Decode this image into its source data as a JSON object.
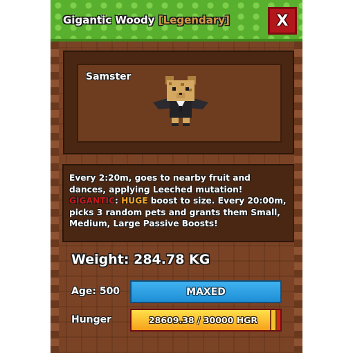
{
  "header": {
    "pet_type": "Gigantic Woody",
    "rarity": "[Legendary]",
    "close_label": "X"
  },
  "preview": {
    "pet_name": "Samster"
  },
  "description": {
    "line1": "Every 2:20m, goes to nearby fruit and dances, applying Leeched mutation!",
    "gigantic_word": "GIGANTIC",
    "colon": ":",
    "huge_word": "HUGE",
    "line2": "boost to size. Every 20:00m, picks 3 random pets and grants them Small, Medium, Large Passive Boosts!"
  },
  "stats": {
    "weight_text": "Weight: 284.78 KG",
    "age_label": "Age: 500",
    "age_status": "MAXED",
    "hunger_label": "Hunger",
    "hunger_text": "28609.38 / 30000 HGR",
    "hunger_current": 28609.38,
    "hunger_max": 30000
  },
  "colors": {
    "header_green": "#59b02e",
    "close_red": "#b3171c",
    "rarity_tan": "#d39a4a",
    "gigantic_red": "#c21a1a",
    "huge_orange": "#f3a62a",
    "age_bar_blue": "#1f8fd6",
    "hunger_yellow": "#ffe14a",
    "hunger_red": "#d9261c"
  }
}
